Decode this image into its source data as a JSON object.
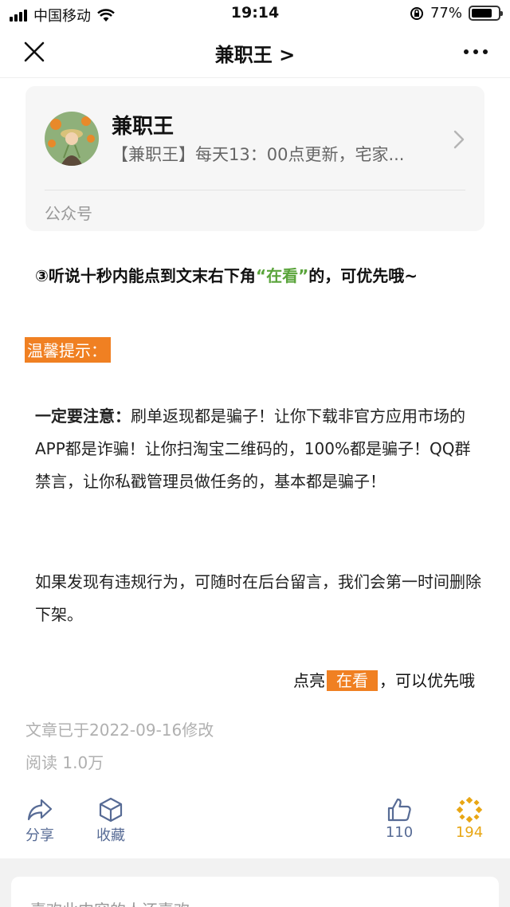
{
  "status": {
    "carrier": "中国移动",
    "time": "19:14",
    "battery": "77%",
    "battery_level": 0.77
  },
  "nav": {
    "title": "兼职王 >"
  },
  "account": {
    "name": "兼职王",
    "description": "【兼职王】每天13：00点更新，宅家...",
    "type": "公众号"
  },
  "article": {
    "para1_before": "③听说十秒内能点到文末右下角",
    "para1_highlight": "“在看”",
    "para1_after": "的，可优先哦~",
    "tip_label": "温馨提示：",
    "para2_bold": "一定要注意：",
    "para2_text": "刷单返现都是骗子！让你下载非官方应用市场的APP都是诈骗！让你扫淘宝二维码的，100%都是骗子！QQ群禁言，让你私戳管理员做任务的，基本都是骗子！",
    "para3": "如果发现有违规行为，可随时在后台留言，我们会第一时间删除下架。",
    "para4_before": "点亮",
    "para4_highlight": "在看",
    "para4_after": "，可以优先哦"
  },
  "meta": {
    "modified": "文章已于2022-09-16修改",
    "reads": "阅读 1.0万"
  },
  "actions": {
    "share": "分享",
    "favorite": "收藏",
    "like_count": "110",
    "wow_count": "194"
  },
  "bottom": {
    "text": "喜欢此内容的人还喜欢"
  },
  "colors": {
    "accent_orange": "#f08022",
    "link_blue": "#576b95",
    "highlight_green": "#5aa43b",
    "wow_gold": "#e8a614"
  }
}
